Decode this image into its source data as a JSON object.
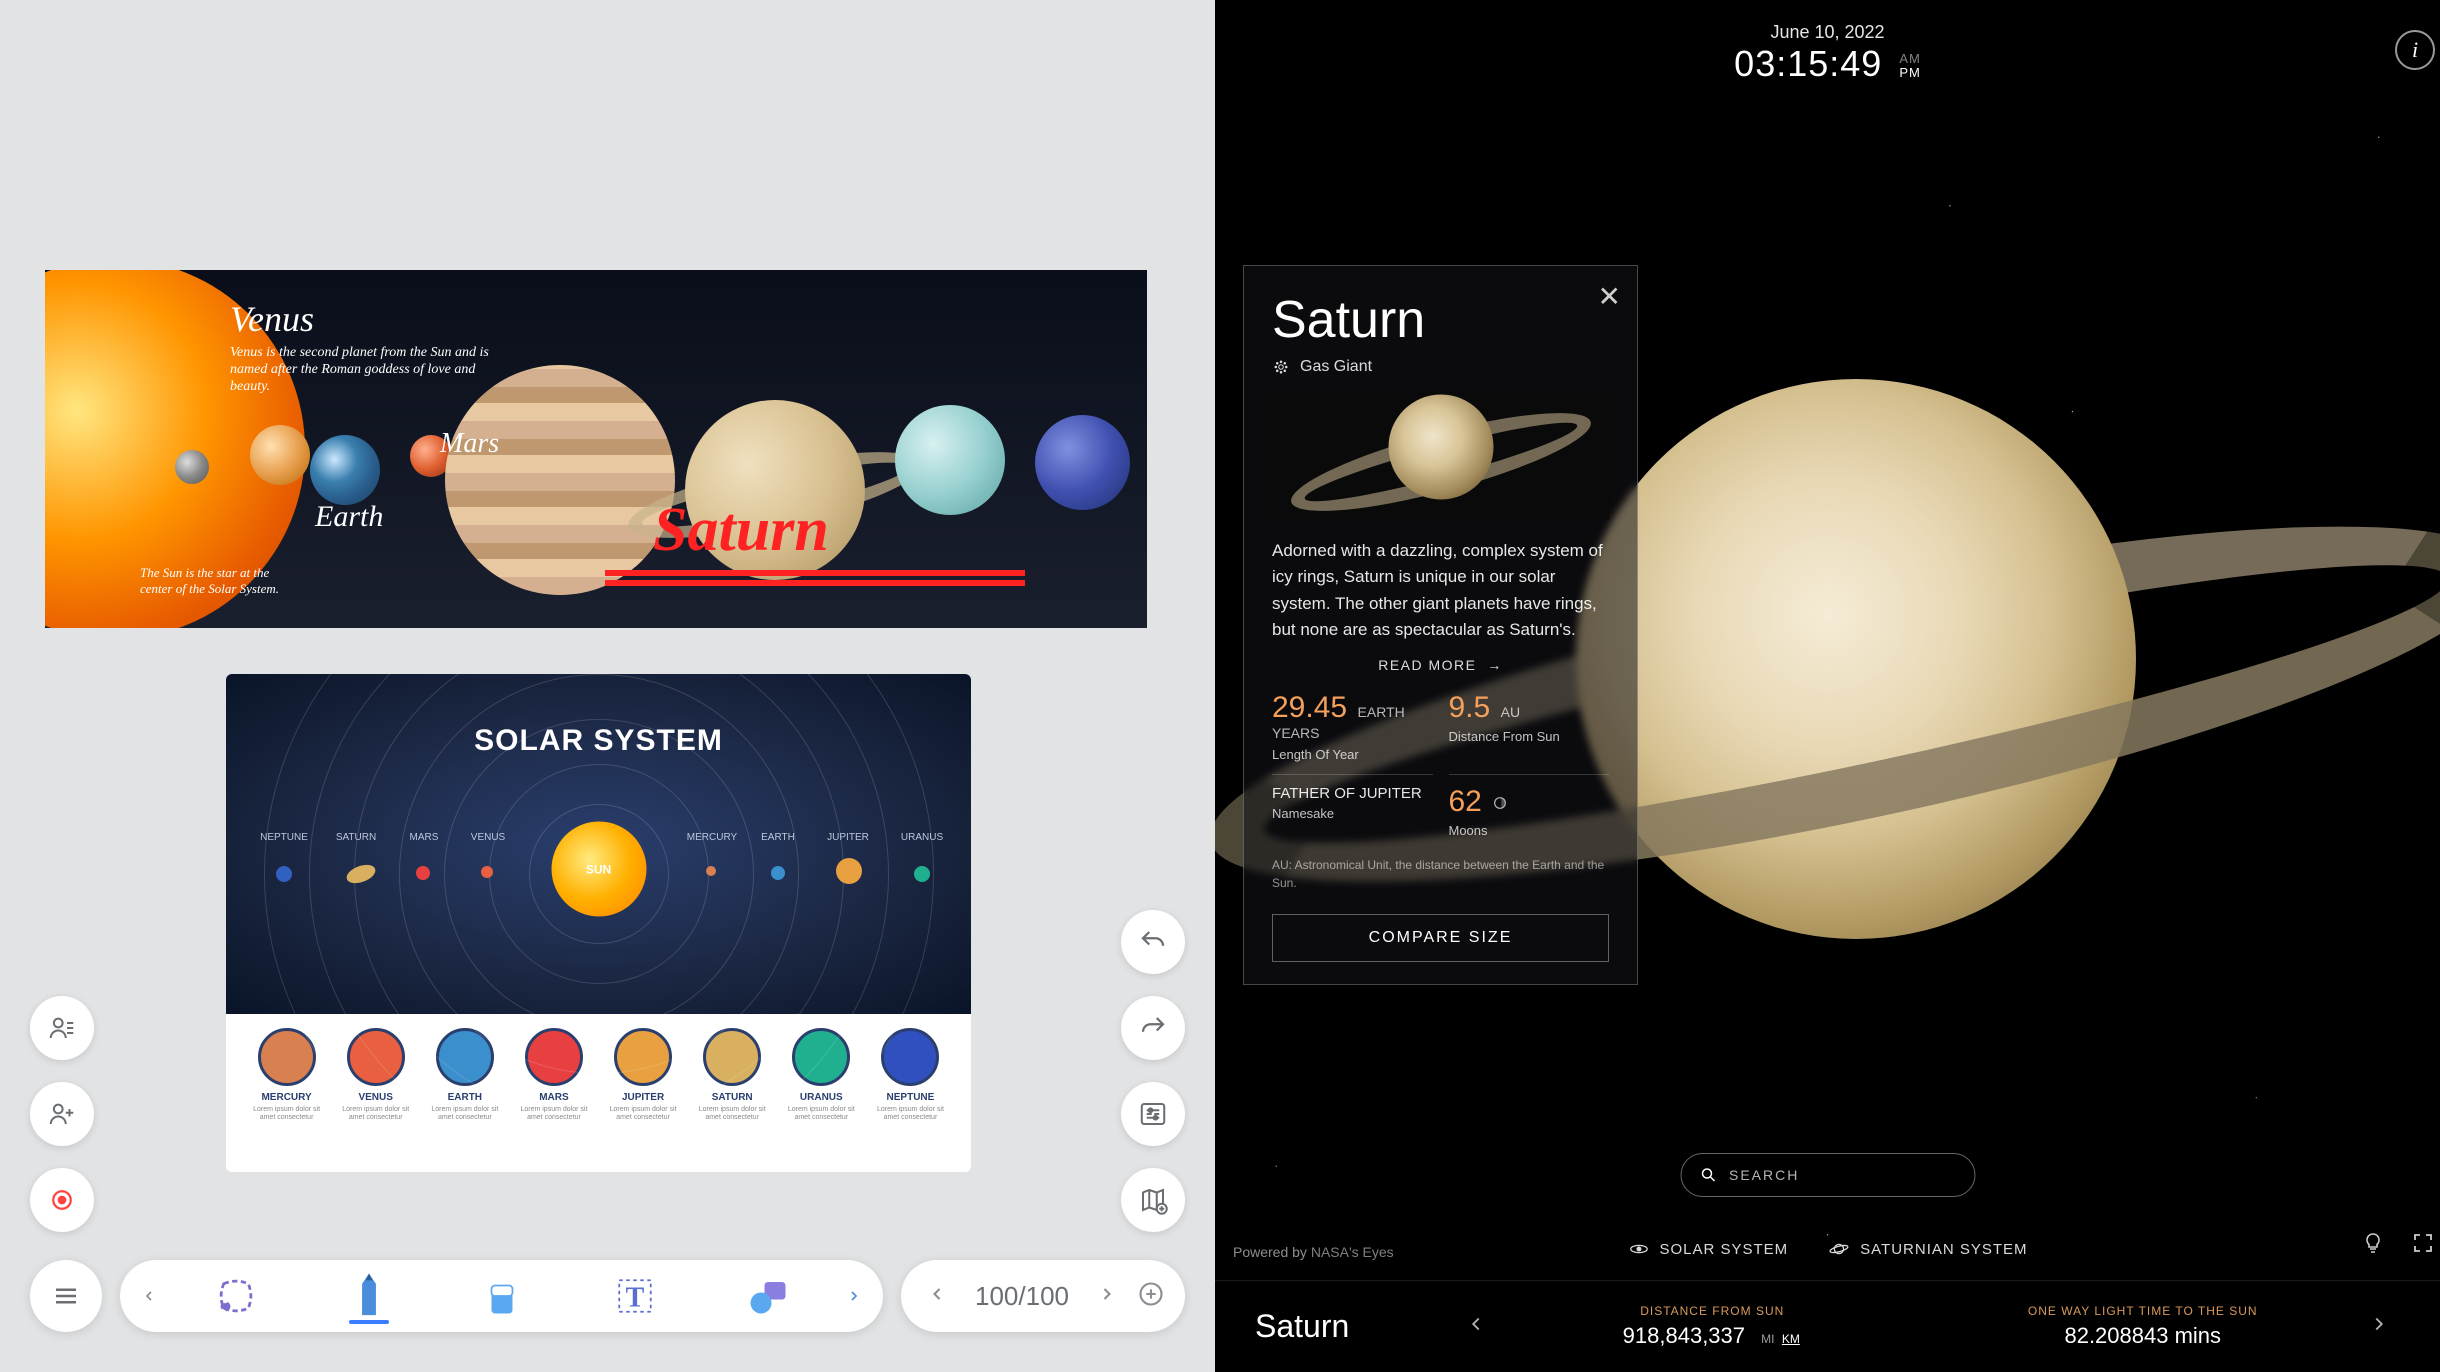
{
  "whiteboard": {
    "planets_image": {
      "venus_title": "Venus",
      "venus_desc": "Venus is the second planet from the Sun and is named after the Roman goddess of love and beauty.",
      "earth_label": "Earth",
      "mars_label": "Mars",
      "saturn_label": "Saturn",
      "sun_desc": "The Sun is the star at the center of the Solar System."
    },
    "infographic": {
      "title": "SOLAR SYSTEM",
      "center_label": "SUN",
      "orbit_labels": [
        "NEPTUNE",
        "SATURN",
        "MARS",
        "VENUS",
        "MERCURY",
        "EARTH",
        "JUPITER",
        "URANUS"
      ],
      "planet_cards": [
        {
          "name": "MERCURY",
          "color": "#d88050"
        },
        {
          "name": "VENUS",
          "color": "#e86040"
        },
        {
          "name": "EARTH",
          "color": "#3a8fcc"
        },
        {
          "name": "MARS",
          "color": "#e84040"
        },
        {
          "name": "JUPITER",
          "color": "#e8a040"
        },
        {
          "name": "SATURN",
          "color": "#d8b060"
        },
        {
          "name": "URANUS",
          "color": "#20b090"
        },
        {
          "name": "NEPTUNE",
          "color": "#3050c0"
        }
      ],
      "card_desc": "Lorem ipsum dolor sit amet consectetur"
    },
    "page_indicator": "100/100"
  },
  "nasa_eyes": {
    "date": "June 10, 2022",
    "time": "03:15:49",
    "am": "AM",
    "pm": "PM",
    "panel": {
      "title": "Saturn",
      "type": "Gas Giant",
      "description": "Adorned with a dazzling, complex system of icy rings, Saturn is unique in our solar system. The other giant planets have rings, but none are as spectacular as Saturn's.",
      "read_more": "READ MORE",
      "stats": {
        "year_value": "29.45",
        "year_unit": "EARTH YEARS",
        "year_label": "Length Of Year",
        "distance_value": "9.5",
        "distance_unit": "AU",
        "distance_label": "Distance From Sun",
        "namesake_value": "FATHER OF JUPITER",
        "namesake_label": "Namesake",
        "moons_value": "62",
        "moons_label": "Moons"
      },
      "au_note": "AU: Astronomical Unit, the distance between the Earth and the Sun.",
      "compare": "COMPARE SIZE"
    },
    "search_placeholder": "SEARCH",
    "tabs": {
      "solar_system": "SOLAR SYSTEM",
      "saturnian_system": "SATURNIAN SYSTEM"
    },
    "powered_by": "Powered by",
    "powered_by_brand": "NASA's Eyes",
    "bottom_bar": {
      "planet": "Saturn",
      "distance_label": "DISTANCE FROM SUN",
      "distance_value": "918,843,337",
      "distance_unit_mi": "MI",
      "distance_unit_km": "KM",
      "light_label": "ONE WAY LIGHT TIME TO THE SUN",
      "light_value": "82.208843 mins"
    }
  }
}
